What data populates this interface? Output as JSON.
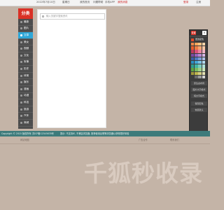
{
  "topbar": {
    "date": "2022年7月10日",
    "weekday": "星期日",
    "links": [
      "我的首页",
      "问题帮助",
      "手机APP"
    ],
    "notice": "我的消息",
    "account": "登录",
    "register": "注册"
  },
  "sidebar": {
    "title": "分类",
    "items": [
      "最新",
      "图片",
      "文章",
      "美女",
      "视频",
      "文化",
      "军事",
      "历史",
      "体育",
      "娱乐",
      "漫画",
      "动漫",
      "科技",
      "旅游",
      "汽车",
      "商城"
    ],
    "active_index": 2
  },
  "search": {
    "placeholder": "输入关键字搜索资讯"
  },
  "color_panel": {
    "title": "设置",
    "close": "×",
    "option_label": "更改配色",
    "swatches": [
      "#f58a4b",
      "#f5a55c",
      "#f9c283",
      "#fbd4a9",
      "#e85d2c",
      "#ec7c44",
      "#f4a672",
      "#f8c8a5",
      "#c03a5b",
      "#d9537a",
      "#e9849e",
      "#f2b3c4",
      "#7b4aa6",
      "#9463be",
      "#b88ad4",
      "#d6b7e6",
      "#3a5ea8",
      "#4f78c0",
      "#7c9bd4",
      "#aebfe5",
      "#2a8fc4",
      "#45a6d6",
      "#7cc1e3",
      "#b1daef",
      "#2f9e8f",
      "#44b3a3",
      "#7bcbbf",
      "#afe0d8",
      "#5da544",
      "#78b85e",
      "#a0d089",
      "#c8e4b7",
      "#a29a3b",
      "#bdb54f",
      "#d4cf84",
      "#e6e2b4",
      "#3c3c3c",
      "#6b6b6b",
      "#9b9b9b",
      "#d2d2d2"
    ],
    "buttons": [
      "原生态布局",
      "图片文字模式",
      "纯文字模式"
    ],
    "buttons2": [
      "保存配色",
      "恢复默认"
    ]
  },
  "footer": {
    "copyright": "Copyright © 2015 版权所有",
    "icp": "苏ICP备12345678号",
    "notice": "提示: 不支持IE, 不兼容浏览器, 推荐使用谷歌等浏览器以获得更好体验"
  },
  "foot2": {
    "left": "网站地图",
    "mid": "广告合作",
    "right": "联系我们"
  },
  "watermark": "千狐秒收录"
}
